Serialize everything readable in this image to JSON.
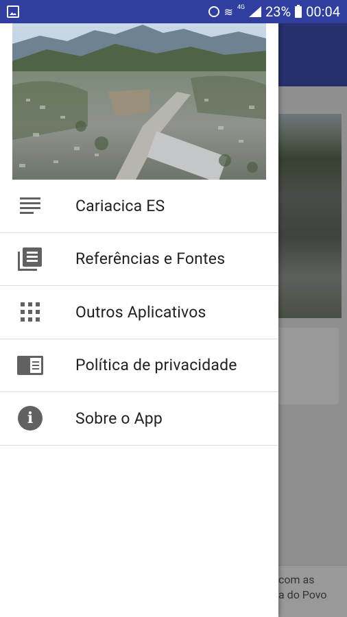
{
  "status_bar": {
    "battery_percent": "23%",
    "time": "00:04",
    "network_type": "4G"
  },
  "background_app": {
    "footer_text_line1": "com as",
    "footer_text_line2": "a do Povo"
  },
  "drawer": {
    "header_image_alt": "",
    "items": [
      {
        "label": "Cariacica ES",
        "icon": "notes-icon"
      },
      {
        "label": "Referências e Fontes",
        "icon": "newspaper-icon"
      },
      {
        "label": "Outros Aplicativos",
        "icon": "apps-grid-icon"
      },
      {
        "label": "Política de privacidade",
        "icon": "book-icon"
      },
      {
        "label": "Sobre o App",
        "icon": "info-icon"
      }
    ]
  },
  "colors": {
    "status_bar": "#303f9f",
    "toolbar": "#3f51b5",
    "icon": "#616161",
    "text": "#212121",
    "divider": "#dcdcdc"
  }
}
